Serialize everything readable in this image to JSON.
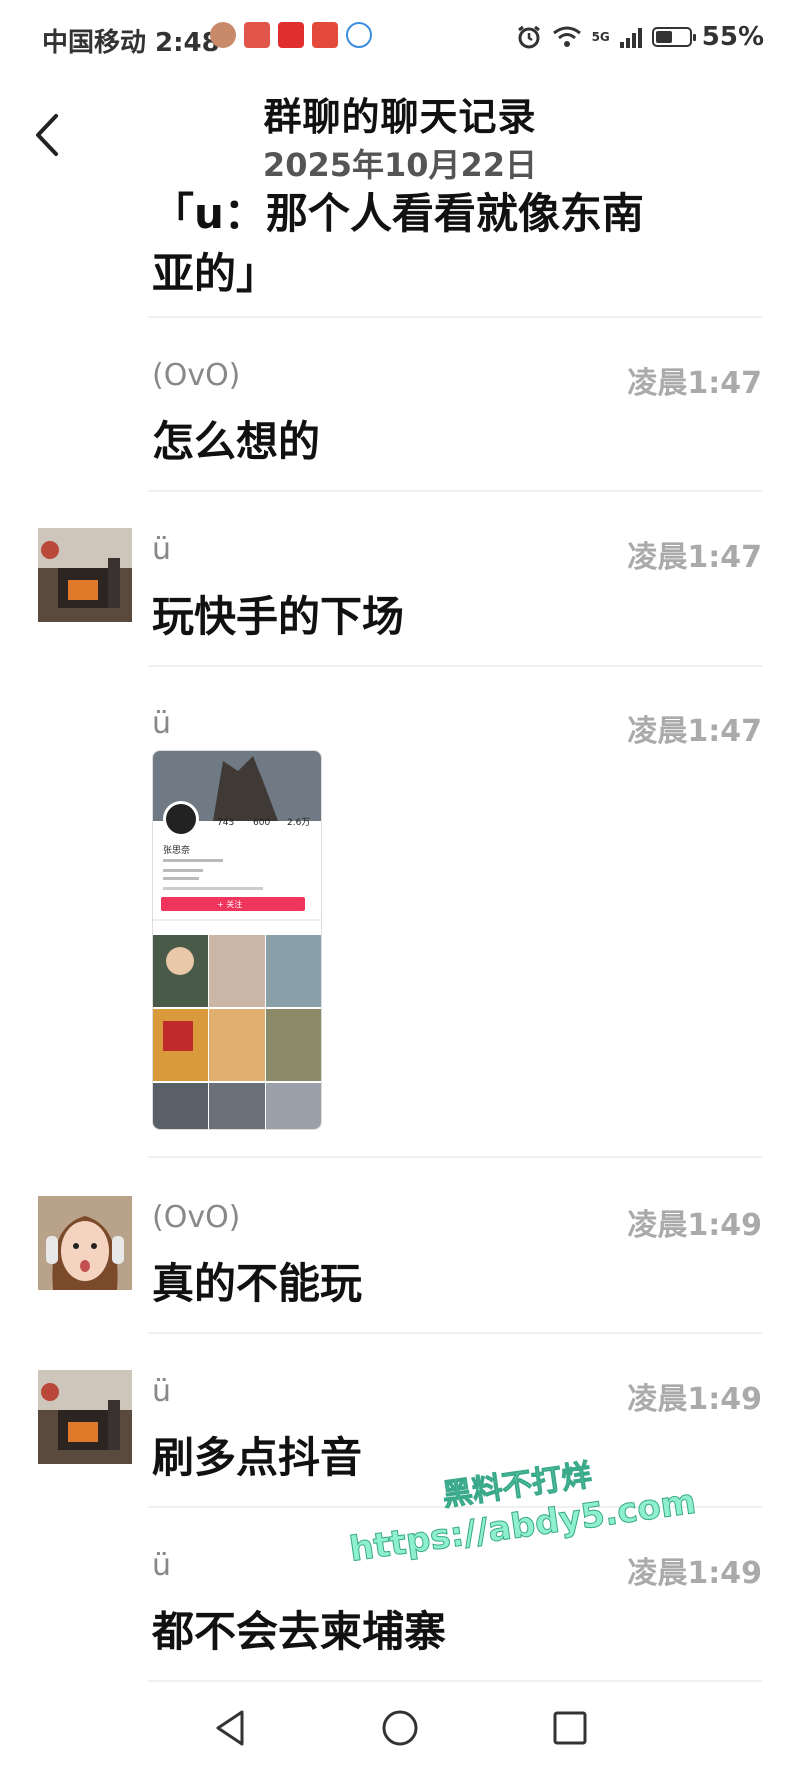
{
  "status_bar": {
    "carrier_time": "中国移动 2:48",
    "network": "5G",
    "battery": "55%",
    "notification_colors": [
      "#e2554b",
      "#e02e2e",
      "#e44a3a",
      "#e04c4c"
    ]
  },
  "header": {
    "title": "群聊的聊天记录",
    "date": "2025年10月22日"
  },
  "cutoff_text": "「u：那个人看看就像东南亚的」",
  "messages": [
    {
      "sender": "(OvO)",
      "time": "凌晨1:47",
      "text": "怎么想的",
      "avatar": "none"
    },
    {
      "sender": "ü",
      "time": "凌晨1:47",
      "text": "玩快手的下场",
      "avatar": "fireplace-photo"
    },
    {
      "sender": "ü",
      "time": "凌晨1:47",
      "image": "profile-screenshot",
      "avatar": "none"
    },
    {
      "sender": "(OvO)",
      "time": "凌晨1:49",
      "text": "真的不能玩",
      "avatar": "girl-photo"
    },
    {
      "sender": "ü",
      "time": "凌晨1:49",
      "text": "刷多点抖音",
      "avatar": "fireplace-photo"
    },
    {
      "sender": "ü",
      "time": "凌晨1:49",
      "text": "都不会去柬埔寨",
      "avatar": "none"
    }
  ],
  "screenshot": {
    "stats": [
      "743",
      "600",
      "2.6万"
    ],
    "name": "张思奈",
    "button": "+ 关注"
  },
  "watermark": {
    "line1": "黑料不打烊",
    "line2": "https://abdy5.com"
  },
  "nav": [
    "back-triangle",
    "home-circle",
    "recents-square"
  ]
}
